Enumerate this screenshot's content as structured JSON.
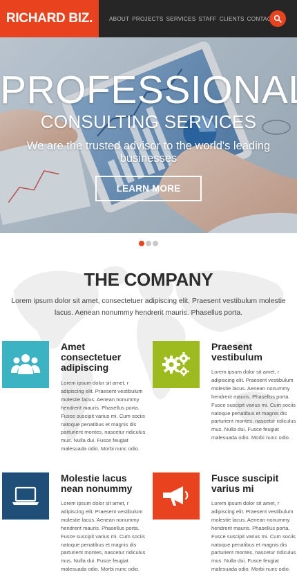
{
  "header": {
    "logo": "RICHARD BIZ.",
    "nav": [
      "ABOUT",
      "PROJECTS",
      "SERVICES",
      "STAFF",
      "CLIENTS",
      "CONTACT US"
    ],
    "search_icon": "search-icon"
  },
  "hero": {
    "title": "PROFESSIONAL",
    "subtitle": "CONSULTING SERVICES",
    "tagline": "We are the trusted advisor to the world's leading businesses",
    "button": "LEARN MORE"
  },
  "slider": {
    "dots": 3,
    "active_index": 0
  },
  "company": {
    "title": "THE COMPANY",
    "description": "Lorem ipsum dolor sit amet, consectetuer adipiscing elit. Praesent vestibulum molestie lacus. Aenean nonummy hendrerit mauris. Phasellus porta.",
    "features": [
      {
        "icon": "users-icon",
        "color": "#3bb3c3",
        "title": "Amet consectetuer adipiscing",
        "text": "Lorem ipsum dolor sit amet, r adipiscing elit. Praesent vestibulum molestie lacus. Aenean nonummy hendrerit mauris. Phasellus porta. Fusce suscipit varius mi. Cum sociis natoque penatibus et magnis dis parturient montes, nascetur ridiculus mus. Nulla dui. Fusce feugiat malesuada odio. Morbi nunc odio."
      },
      {
        "icon": "gears-icon",
        "color": "#9dbb1e",
        "title": "Praesent vestibulum",
        "text": "Lorem ipsum dolor sit amet, r adipiscing elit. Praesent vestibulum molestie lacus. Aenean nonummy hendrerit mauris. Phasellus porta. Fusce suscipit varius mi. Cum sociis natoque penatibus et magnis dis parturient montes, nascetur ridiculus mus. Nulla dui. Fusce feugiat malesuada odio. Morbi nunc odio."
      },
      {
        "icon": "laptop-icon",
        "color": "#1f4e79",
        "title": "Molestie lacus nean nonummy",
        "text": "Lorem ipsum dolor sit amet, r adipiscing elit. Praesent vestibulum molestie lacus. Aenean nonummy hendrerit mauris. Phasellus porta. Fusce suscipit varius mi. Cum sociis natoque penatibus et magnis dis parturient montes, nascetur ridiculus mus. Nulla dui. Fusce feugiat malesuada odio. Morbi nunc odio."
      },
      {
        "icon": "megaphone-icon",
        "color": "#e8421f",
        "title": "Fusce suscipit varius mi",
        "text": "Lorem ipsum dolor sit amet, r adipiscing elit. Praesent vestibulum molestie lacus. Aenean nonummy hendrerit mauris. Phasellus porta. Fusce suscipit varius mi. Cum sociis natoque penatibus et magnis dis parturient montes, nascetur ridiculus mus. Nulla dui. Fusce feugiat malesuada odio. Morbi nunc odio."
      }
    ]
  },
  "colors": {
    "accent": "#e8421f",
    "header_bg": "#262626"
  }
}
